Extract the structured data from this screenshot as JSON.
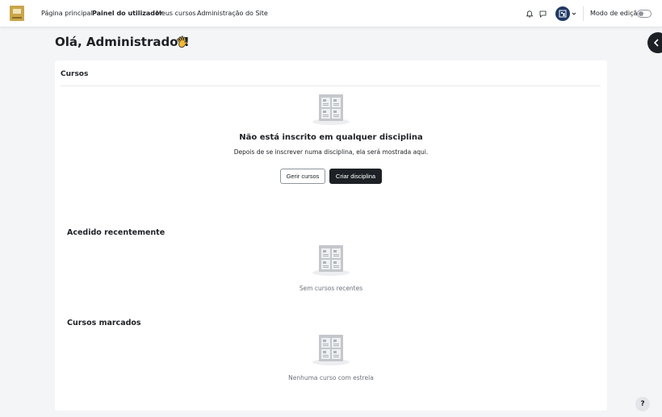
{
  "nav": {
    "items": [
      "Página principal",
      "Painel do utilizador",
      "Meus cursos",
      "Administração do Site"
    ],
    "edit_mode_label": "Modo de edição"
  },
  "greeting": "Olá, Administrador!",
  "card": {
    "title": "Cursos",
    "empty_title": "Não está inscrito em qualquer disciplina",
    "empty_desc": "Depois de se inscrever numa disciplina, ela será mostrada aqui.",
    "manage_button": "Gerir cursos",
    "create_button": "Criar disciplina"
  },
  "recent": {
    "title": "Acedido recentemente",
    "empty": "Sem cursos recentes"
  },
  "starred": {
    "title": "Cursos marcados",
    "empty": "Nenhuma curso com estrela"
  },
  "help_label": "?",
  "colors": {
    "accent_dark": "#1d2125",
    "avatar": "#1f3864",
    "logo": "#c9a54a"
  }
}
